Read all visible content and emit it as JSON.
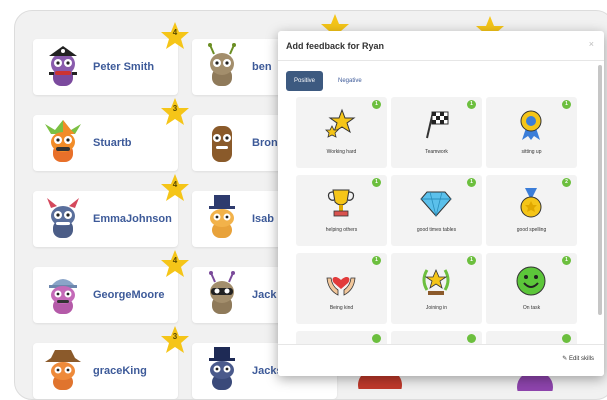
{
  "students": [
    {
      "name": "Peter Smith",
      "points": "4"
    },
    {
      "name": "ben",
      "points": ""
    },
    {
      "name": "Stuartb",
      "points": "3"
    },
    {
      "name": "Bron",
      "points": ""
    },
    {
      "name": "EmmaJohnson",
      "points": "4"
    },
    {
      "name": "Isab",
      "points": ""
    },
    {
      "name": "GeorgeMoore",
      "points": "4"
    },
    {
      "name": "Jack",
      "points": ""
    },
    {
      "name": "graceKing",
      "points": "3"
    },
    {
      "name": "Jacks",
      "points": ""
    }
  ],
  "modal": {
    "title": "Add feedback for Ryan",
    "close": "×",
    "tabs": [
      {
        "label": "Positive"
      },
      {
        "label": "Negative"
      }
    ],
    "skills": [
      {
        "label": "Working hard",
        "count": "1",
        "icon": "stars-icon"
      },
      {
        "label": "Teamwork",
        "count": "1",
        "icon": "checkered-flags-icon"
      },
      {
        "label": "sitting up",
        "count": "1",
        "icon": "rosette-icon"
      },
      {
        "label": "helping others",
        "count": "1",
        "icon": "trophy-icon"
      },
      {
        "label": "good times tables",
        "count": "1",
        "icon": "diamond-icon"
      },
      {
        "label": "good spelling",
        "count": "2",
        "icon": "medal-icon"
      },
      {
        "label": "Being kind",
        "count": "1",
        "icon": "heart-hands-icon"
      },
      {
        "label": "Joining in",
        "count": "1",
        "icon": "laurel-star-icon"
      },
      {
        "label": "On task",
        "count": "1",
        "icon": "smiley-icon"
      }
    ],
    "edit_label": "Edit skills",
    "edit_icon": "pencil-icon"
  }
}
